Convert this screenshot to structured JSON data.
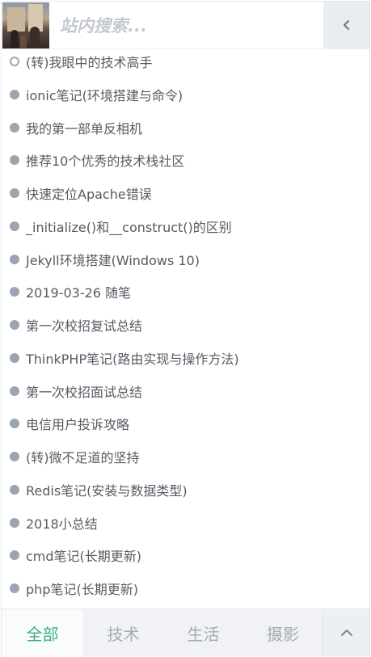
{
  "search": {
    "placeholder": "站内搜索..."
  },
  "posts": [
    {
      "title": "(转)我眼中的技术高手",
      "marker": "hollow"
    },
    {
      "title": "ionic笔记(环境搭建与命令)",
      "marker": "filled"
    },
    {
      "title": "我的第一部单反相机",
      "marker": "filled"
    },
    {
      "title": "推荐10个优秀的技术栈社区",
      "marker": "filled"
    },
    {
      "title": "快速定位Apache错误",
      "marker": "filled"
    },
    {
      "title": "_initialize()和__construct()的区别",
      "marker": "filled"
    },
    {
      "title": "Jekyll环境搭建(Windows 10)",
      "marker": "filled"
    },
    {
      "title": "2019-03-26 随笔",
      "marker": "filled"
    },
    {
      "title": "第一次校招复试总结",
      "marker": "filled"
    },
    {
      "title": "ThinkPHP笔记(路由实现与操作方法)",
      "marker": "filled"
    },
    {
      "title": "第一次校招面试总结",
      "marker": "filled"
    },
    {
      "title": "电信用户投诉攻略",
      "marker": "filled"
    },
    {
      "title": "(转)微不足道的坚持",
      "marker": "filled"
    },
    {
      "title": "Redis笔记(安装与数据类型)",
      "marker": "filled"
    },
    {
      "title": "2018小总结",
      "marker": "filled"
    },
    {
      "title": "cmd笔记(长期更新)",
      "marker": "filled"
    },
    {
      "title": "php笔记(长期更新)",
      "marker": "filled"
    }
  ],
  "tabs": [
    {
      "label": "全部",
      "active": true
    },
    {
      "label": "技术",
      "active": false
    },
    {
      "label": "生活",
      "active": false
    },
    {
      "label": "摄影",
      "active": false
    }
  ],
  "icons": {
    "collapse": "chevron-left-icon",
    "scroll_top": "chevron-up-icon"
  },
  "colors": {
    "accent": "#3eaf7c",
    "dot": "#9aa5b1",
    "text": "#555b62",
    "tab_inactive": "#a3abb4"
  }
}
